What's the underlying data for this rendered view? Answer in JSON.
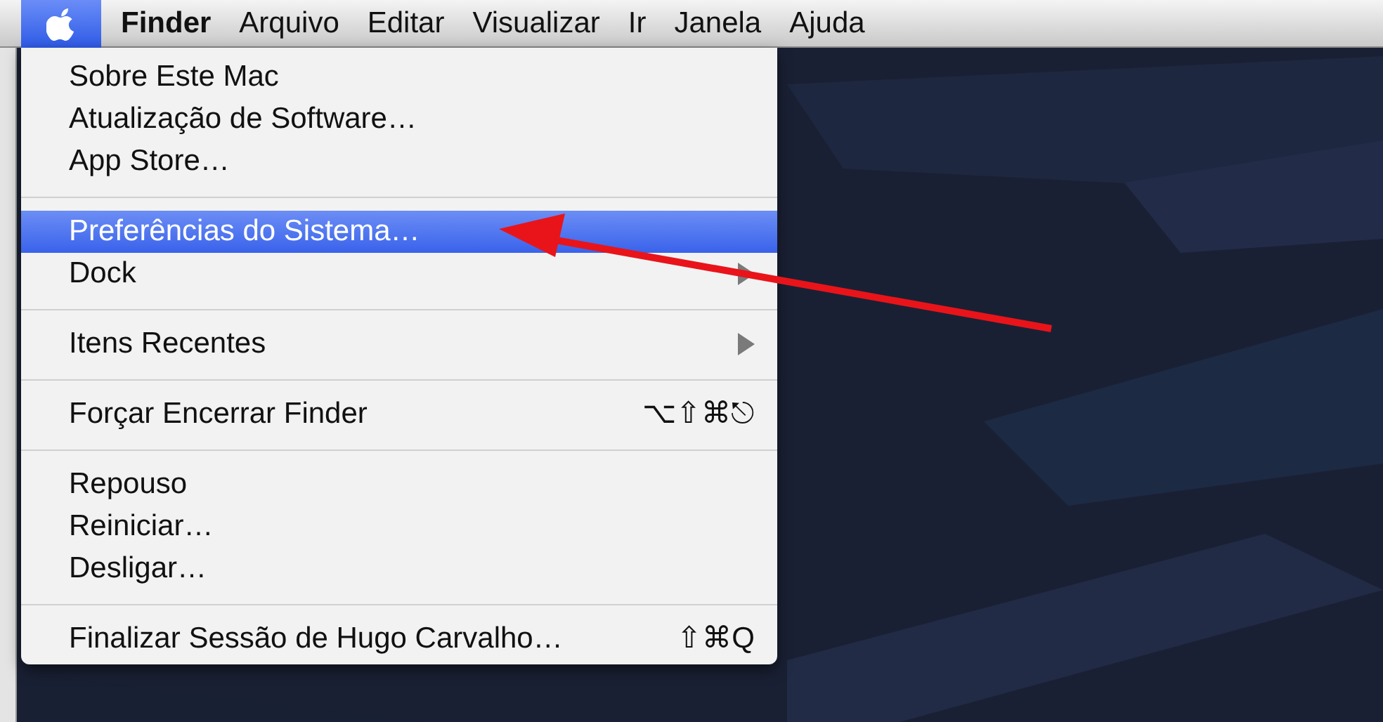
{
  "menu_bar": {
    "apple_selected": true,
    "items": [
      {
        "label": "Finder",
        "bold": true
      },
      {
        "label": "Arquivo",
        "bold": false
      },
      {
        "label": "Editar",
        "bold": false
      },
      {
        "label": "Visualizar",
        "bold": false
      },
      {
        "label": "Ir",
        "bold": false
      },
      {
        "label": "Janela",
        "bold": false
      },
      {
        "label": "Ajuda",
        "bold": false
      }
    ]
  },
  "apple_menu": {
    "items": [
      {
        "kind": "item",
        "label": "Sobre Este Mac",
        "selected": false,
        "submenu": false
      },
      {
        "kind": "item",
        "label": "Atualização de Software…",
        "selected": false,
        "submenu": false
      },
      {
        "kind": "item",
        "label": "App Store…",
        "selected": false,
        "submenu": false
      },
      {
        "kind": "separator"
      },
      {
        "kind": "item",
        "label": "Preferências do Sistema…",
        "selected": true,
        "submenu": false
      },
      {
        "kind": "item",
        "label": "Dock",
        "selected": false,
        "submenu": true
      },
      {
        "kind": "separator"
      },
      {
        "kind": "item",
        "label": "Itens Recentes",
        "selected": false,
        "submenu": true
      },
      {
        "kind": "separator"
      },
      {
        "kind": "item",
        "label": "Forçar Encerrar Finder",
        "selected": false,
        "submenu": false,
        "shortcut": "⌥⇧⌘⎋"
      },
      {
        "kind": "separator"
      },
      {
        "kind": "item",
        "label": "Repouso",
        "selected": false,
        "submenu": false
      },
      {
        "kind": "item",
        "label": "Reiniciar…",
        "selected": false,
        "submenu": false
      },
      {
        "kind": "item",
        "label": "Desligar…",
        "selected": false,
        "submenu": false
      },
      {
        "kind": "separator"
      },
      {
        "kind": "item",
        "label": "Finalizar Sessão de Hugo Carvalho…",
        "selected": false,
        "submenu": false,
        "shortcut": "⇧⌘Q"
      }
    ]
  }
}
